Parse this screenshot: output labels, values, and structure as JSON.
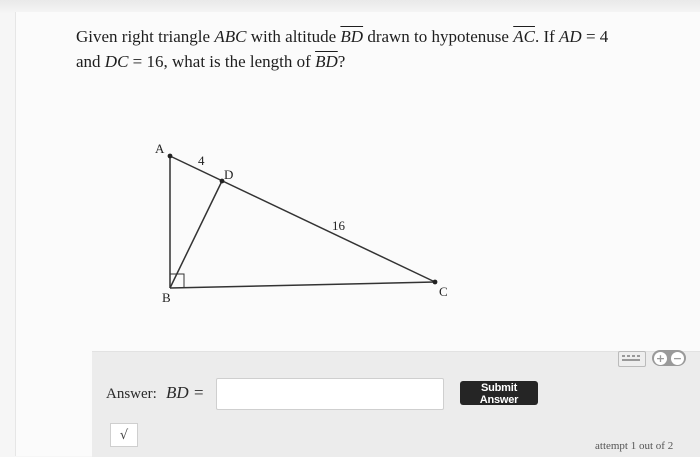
{
  "question": {
    "t1": "Given right triangle ",
    "abc": "ABC",
    "t2": " with altitude ",
    "bd": "BD",
    "t3": " drawn to hypotenuse ",
    "ac": "AC",
    "t4": ". If ",
    "ad": "AD",
    "t5": " = 4",
    "t6": "and ",
    "dc": "DC",
    "t7": " = 16, what is the length of ",
    "bd2": "BD",
    "t8": "?"
  },
  "figure": {
    "label_a": "A",
    "label_b": "B",
    "label_c": "C",
    "label_d": "D",
    "seg_ad": "4",
    "seg_dc": "16"
  },
  "answer": {
    "label": "Answer:",
    "variable": "BD =",
    "value": "",
    "submit_label": "Submit Answer",
    "sqrt_label": "√"
  },
  "attempt_text": "attempt 1 out of 2"
}
